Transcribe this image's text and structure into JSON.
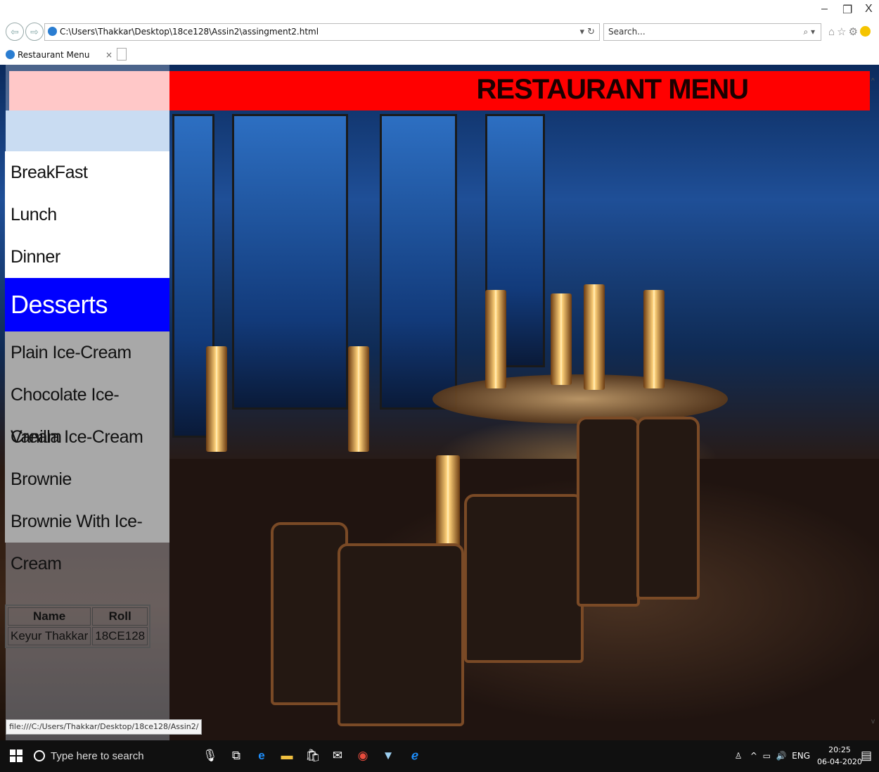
{
  "browser": {
    "address": "C:\\Users\\Thakkar\\Desktop\\18ce128\\Assin2\\assingment2.html",
    "search_placeholder": "Search...",
    "tab_title": "Restaurant Menu",
    "status_url": "file:///C:/Users/Thakkar/Desktop/18ce128/Assin2/"
  },
  "page": {
    "banner_title": "RESTAURANT MENU",
    "menu": [
      {
        "label": "BreakFast"
      },
      {
        "label": "Lunch"
      },
      {
        "label": "Dinner"
      },
      {
        "label": "Desserts"
      },
      {
        "label": "Plain Ice-Cream"
      },
      {
        "label": "Chocolate Ice-Cream"
      },
      {
        "label": "Vanilla Ice-Cream"
      },
      {
        "label": "Brownie"
      },
      {
        "label": "Brownie With Ice-Cream"
      }
    ],
    "table": {
      "headers": [
        "Name",
        "Roll"
      ],
      "row": [
        "Keyur Thakkar",
        "18CE128"
      ]
    },
    "colors": {
      "banner": "#ff0000",
      "active_menu": "#0000ff",
      "submenu": "#a8a8a8"
    }
  },
  "taskbar": {
    "search_placeholder": "Type here to search",
    "language": "ENG",
    "time": "20:25",
    "date": "06-04-2020"
  }
}
